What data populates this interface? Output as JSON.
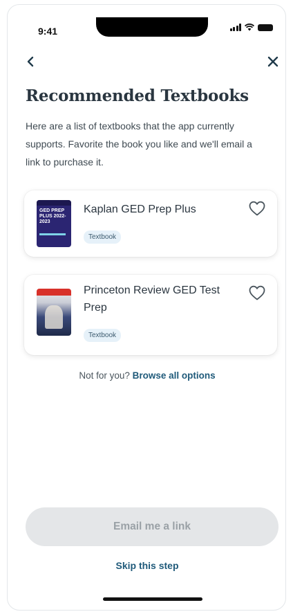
{
  "status_bar": {
    "time": "9:41"
  },
  "nav": {
    "back_icon": "chevron-left-icon",
    "close_icon": "close-icon"
  },
  "page": {
    "title": "Recommended Textbooks",
    "description": "Here are a list of textbooks that the app currently supports. Favorite the book you like and we'll email a link to purchase it."
  },
  "books": [
    {
      "title": "Kaplan GED Prep Plus",
      "badge": "Textbook",
      "cover_text": "GED PREP PLUS 2022-2023"
    },
    {
      "title": "Princeton Review GED Test Prep",
      "badge": "Textbook"
    }
  ],
  "browse": {
    "prefix": "Not for you?",
    "link": "Browse all options"
  },
  "actions": {
    "email_button": "Email me a link",
    "skip": "Skip this step"
  },
  "colors": {
    "accent": "#1f5a7a",
    "badge_bg": "#e6f1f9",
    "button_disabled": "#e4e6e8"
  }
}
